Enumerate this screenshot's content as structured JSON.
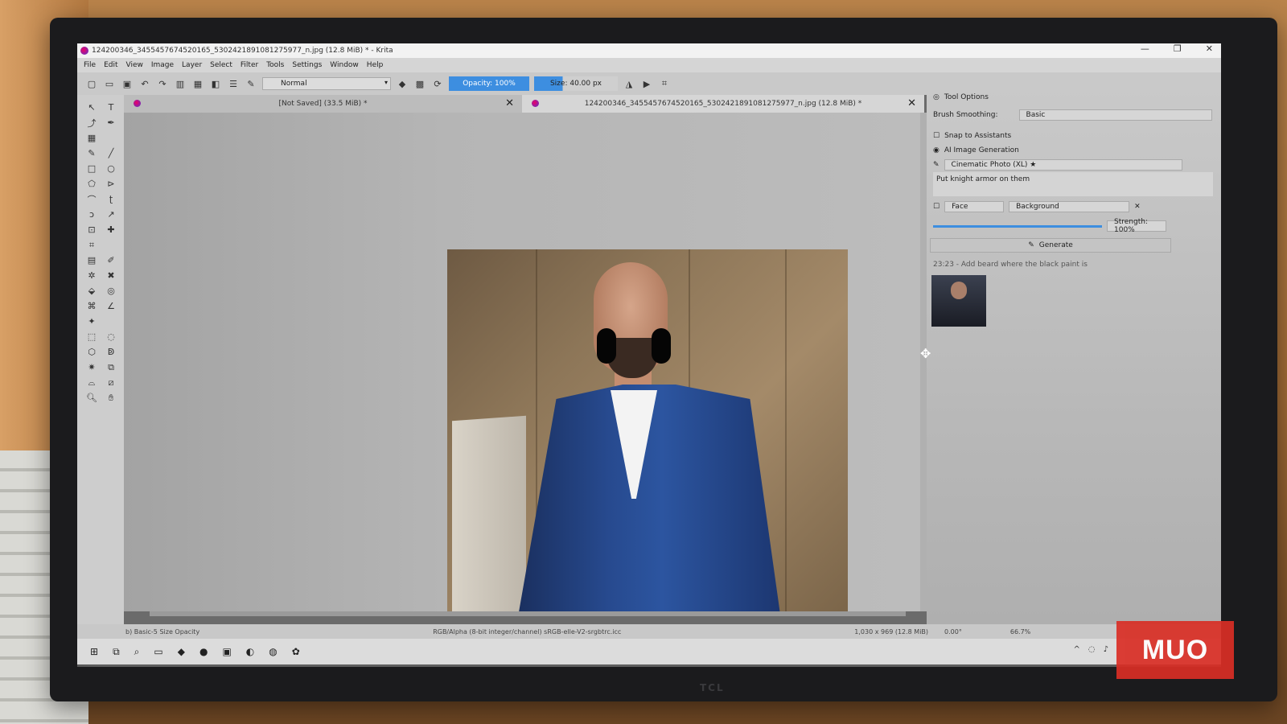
{
  "window": {
    "title": "124200346_3455457674520165_5302421891081275977_n.jpg (12.8 MiB) * - Krita",
    "minimize": "—",
    "maximize": "❐",
    "close": "✕"
  },
  "menu": [
    "File",
    "Edit",
    "View",
    "Image",
    "Layer",
    "Select",
    "Filter",
    "Tools",
    "Settings",
    "Window",
    "Help"
  ],
  "toolbar": {
    "blend_mode": "Normal",
    "opacity_label": "Opacity: 100%",
    "size_label": "Size: 40.00 px"
  },
  "tabs": [
    {
      "label": "[Not Saved]  (33.5 MiB) *"
    },
    {
      "label": "124200346_3455457674520165_5302421891081275977_n.jpg (12.8 MiB) *"
    }
  ],
  "docker": {
    "tool_options_title": "Tool Options",
    "brush_smoothing_label": "Brush Smoothing:",
    "brush_smoothing_value": "Basic",
    "snap_label": "Snap to Assistants",
    "ai_title": "AI Image Generation",
    "model": "Cinematic Photo (XL) ★",
    "prompt": "Put knight armor on them",
    "region_label": "Face",
    "region_target": "Background",
    "strength_label": "Strength: 100%",
    "generate_label": "Generate",
    "history_item": "23:23 - Add beard where the black paint is"
  },
  "statusbar": {
    "brush": "b) Basic-5 Size Opacity",
    "color_profile": "RGB/Alpha (8-bit integer/channel)  sRGB-elle-V2-srgbtrc.icc",
    "dimensions": "1,030 x 969 (12.8 MiB)",
    "rotation": "0.00°",
    "zoom": "66.7%"
  },
  "monitor_brand": "TCL",
  "watermark": "MUO"
}
